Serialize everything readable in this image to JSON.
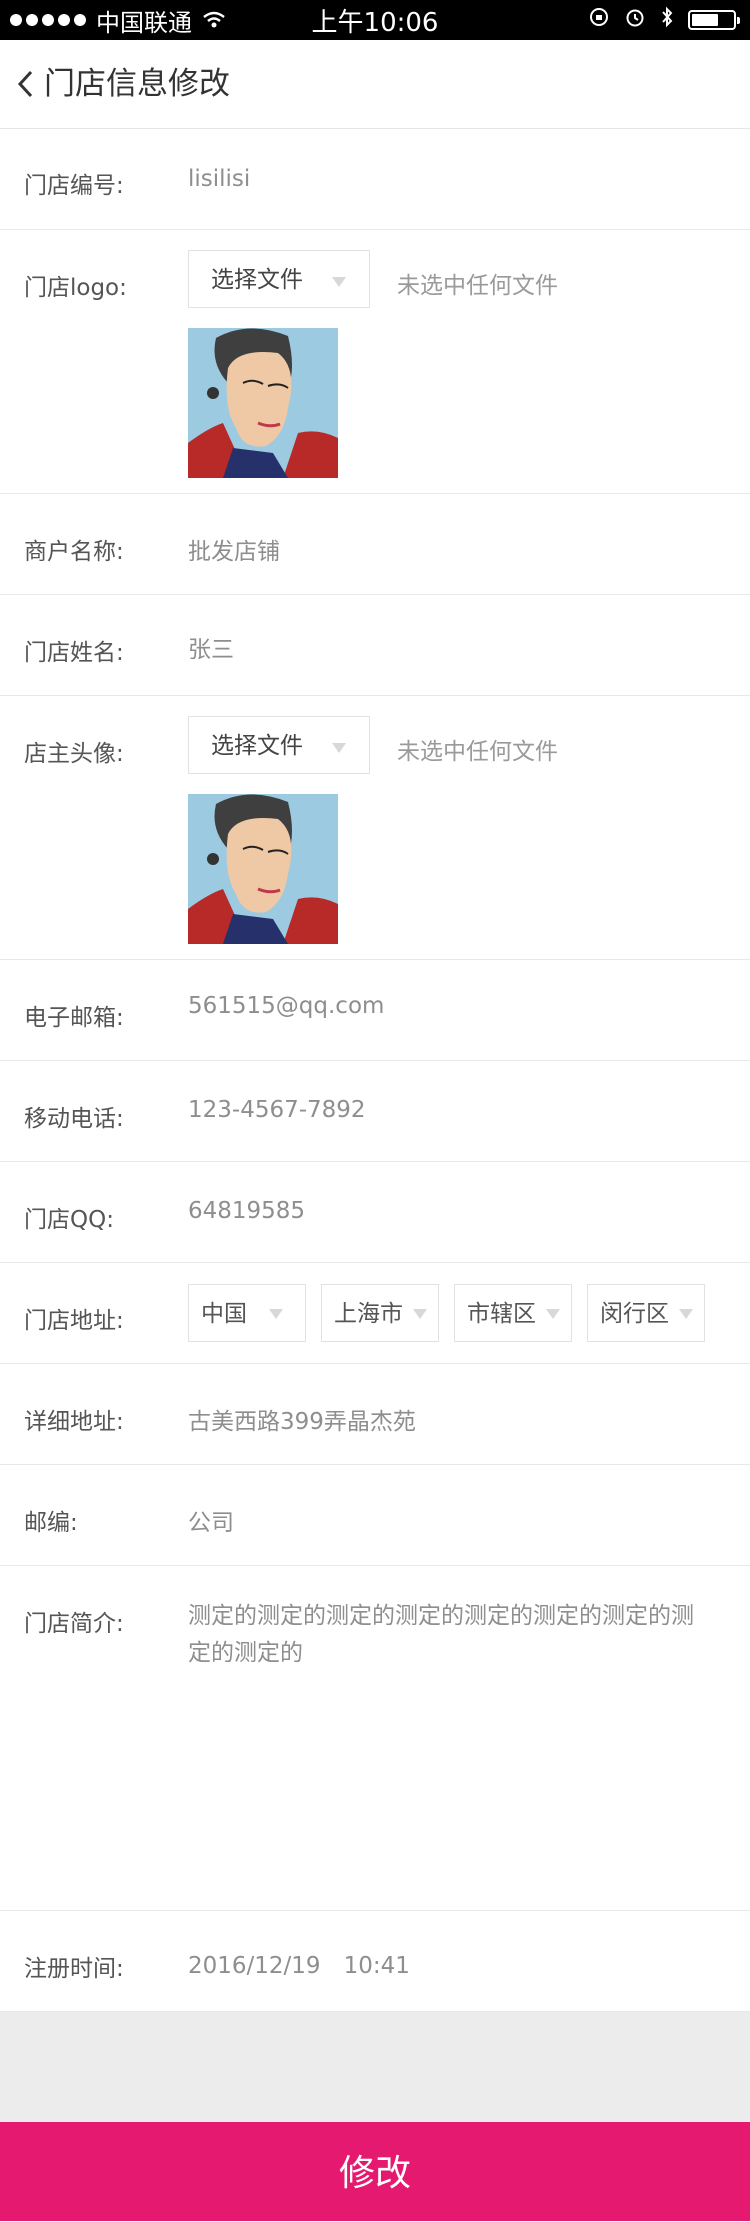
{
  "status_bar": {
    "carrier": "中国联通",
    "time": "上午10:06",
    "battery_level": 0.65
  },
  "nav": {
    "title": "门店信息修改"
  },
  "form": {
    "store_id": {
      "label": "门店编号:",
      "value": "lisilisi"
    },
    "store_logo": {
      "label": "门店logo:",
      "button_label": "选择文件",
      "no_file_text": "未选中任何文件"
    },
    "merchant_name": {
      "label": "商户名称:",
      "value": "批发店铺"
    },
    "store_owner_name": {
      "label": "门店姓名:",
      "value": "张三"
    },
    "owner_avatar": {
      "label": "店主头像:",
      "button_label": "选择文件",
      "no_file_text": "未选中任何文件"
    },
    "email": {
      "label": "电子邮箱:",
      "value": "561515@qq.com"
    },
    "mobile": {
      "label": "移动电话:",
      "value": "123-4567-7892"
    },
    "qq": {
      "label": "门店QQ:",
      "value": "64819585"
    },
    "address": {
      "label": "门店地址:",
      "country": "中国",
      "city": "上海市",
      "district_type": "市辖区",
      "district": "闵行区"
    },
    "detail_address": {
      "label": "详细地址:",
      "value": "古美西路399弄晶杰苑"
    },
    "postcode": {
      "label": "邮编:",
      "value": "公司"
    },
    "intro": {
      "label": "门店简介:",
      "value": "测定的测定的测定的测定的测定的测定的测定的测定的测定的"
    },
    "register_time": {
      "label": "注册时间:",
      "value": "2016/12/19　10:41"
    }
  },
  "submit": {
    "label": "修改"
  },
  "colors": {
    "accent": "#e4196f",
    "gray_area": "#ececec",
    "status_bar": "#000000"
  }
}
